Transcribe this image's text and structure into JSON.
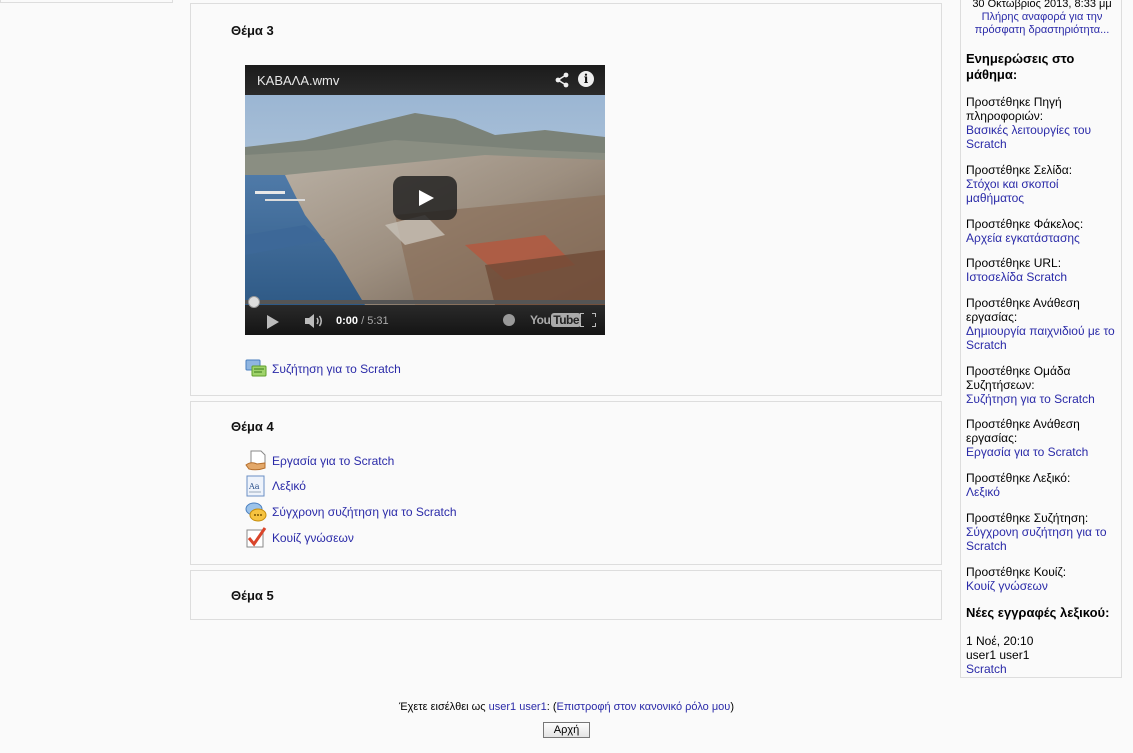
{
  "sections": [
    {
      "title": "Θέμα 3",
      "video": {
        "title": "ΚΑΒΑΛΑ.wmv",
        "current_time": "0:00",
        "separator": "/",
        "duration": "5:31",
        "brand_you": "You",
        "brand_tube": "Tube",
        "played_fraction": 0.0
      },
      "activities": [
        {
          "label": "Συζήτηση για το Scratch",
          "icon": "forum-icon"
        }
      ]
    },
    {
      "title": "Θέμα 4",
      "activities": [
        {
          "label": "Εργασία για το Scratch",
          "icon": "assignment-icon"
        },
        {
          "label": "Λεξικό",
          "icon": "glossary-icon"
        },
        {
          "label": "Σύγχρονη συζήτηση για το Scratch",
          "icon": "chat-icon"
        },
        {
          "label": "Κουίζ γνώσεων",
          "icon": "quiz-icon"
        }
      ]
    },
    {
      "title": "Θέμα 5",
      "activities": []
    }
  ],
  "sidebar": {
    "date": "30 Οκτωβριος 2013, 8:33 μμ",
    "report_link": "Πλήρης αναφορά για την πρόσφατη δραστηριότητα...",
    "updates_heading": "Ενημερώσεις στο μάθημα:",
    "updates": [
      {
        "label": "Προστέθηκε Πηγή πληροφοριών:",
        "link": "Βασικές λειτουργίες του Scratch"
      },
      {
        "label": "Προστέθηκε Σελίδα:",
        "link": "Στόχοι και σκοποί μαθήματος"
      },
      {
        "label": "Προστέθηκε Φάκελος:",
        "link": "Αρχεία εγκατάστασης"
      },
      {
        "label": "Προστέθηκε URL:",
        "link": "Ιστοσελίδα Scratch"
      },
      {
        "label": "Προστέθηκε Ανάθεση εργασίας:",
        "link": "Δημιουργία παιχνιδιού με το Scratch"
      },
      {
        "label": "Προστέθηκε Ομάδα Συζητήσεων:",
        "link": "Συζήτηση για το Scratch"
      },
      {
        "label": "Προστέθηκε Ανάθεση εργασίας:",
        "link": "Εργασία για το Scratch"
      },
      {
        "label": "Προστέθηκε Λεξικό:",
        "link": "Λεξικό"
      },
      {
        "label": "Προστέθηκε Συζήτηση:",
        "link": "Σύγχρονη συζήτηση για το Scratch"
      },
      {
        "label": "Προστέθηκε Κουίζ:",
        "link": "Κουίζ γνώσεων"
      }
    ],
    "glossary_heading": "Νέες εγγραφές λεξικού:",
    "glossary_entry": {
      "date": "1 Νοέ, 20:10",
      "user": "user1 user1",
      "term": "Scratch"
    }
  },
  "footer": {
    "logged_in_prefix": "Έχετε εισέλθει ως ",
    "user": "user1 user1",
    "paren_open": ": (",
    "return_link": "Επιστροφή στον κανονικό ρόλο μου",
    "paren_close": ")",
    "home_button": "Αρχή"
  },
  "colors": {
    "link": "#2a2aa8",
    "border": "#dddddd",
    "background": "#fafafa"
  }
}
